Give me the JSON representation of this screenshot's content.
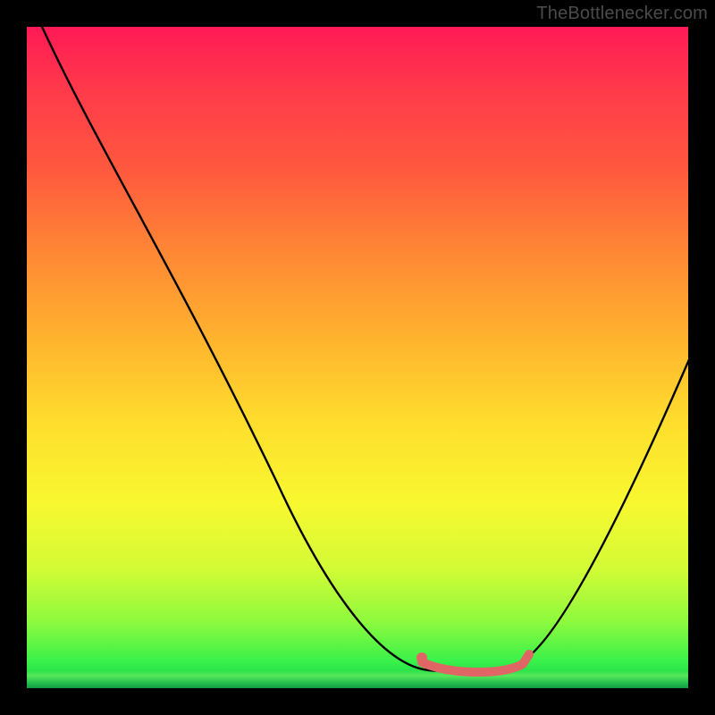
{
  "attribution": "TheBottlenecker.com",
  "colors": {
    "frame": "#000000",
    "gradient_top": "#ff1a55",
    "gradient_mid": "#ffde2d",
    "gradient_bottom": "#13c94a",
    "curve": "#000000",
    "marker": "#e06666"
  },
  "chart_data": {
    "type": "line",
    "title": "",
    "xlabel": "",
    "ylabel": "",
    "xlim": [
      0,
      100
    ],
    "ylim": [
      0,
      100
    ],
    "series": [
      {
        "name": "bottleneck-curve",
        "x": [
          1,
          30,
          55,
          62,
          72,
          77,
          100
        ],
        "values": [
          100,
          55,
          8,
          2,
          2,
          8,
          50
        ]
      }
    ],
    "annotations": [
      {
        "name": "optimal-range-marker",
        "x_start": 62,
        "x_end": 74,
        "y": 3
      }
    ],
    "gradient_meaning": "vertical color = bottleneck severity (red high, green low)"
  }
}
